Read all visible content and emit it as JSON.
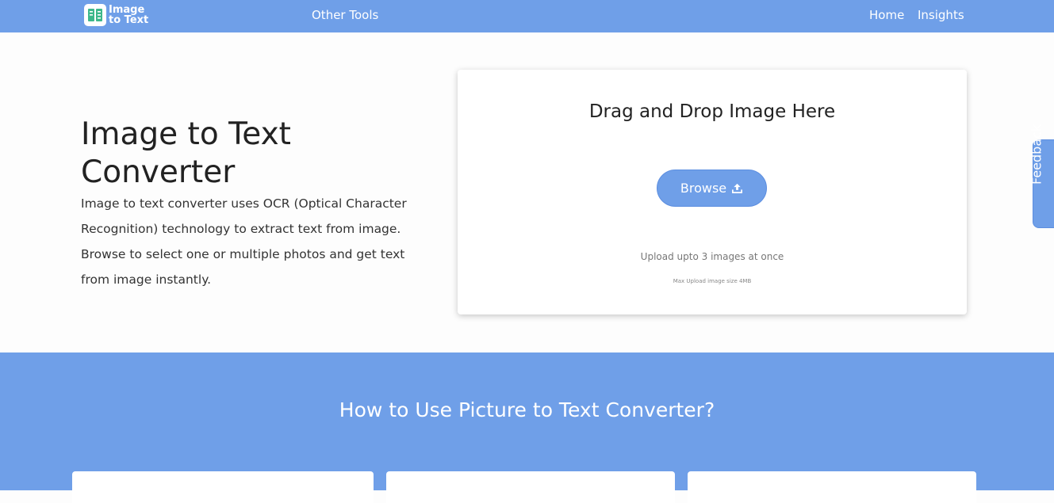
{
  "navbar": {
    "logo": {
      "line1": "Image",
      "line2": "to Text"
    },
    "links": {
      "other_tools": "Other Tools",
      "home": "Home",
      "insights": "Insights"
    }
  },
  "hero": {
    "title": "Image to Text Converter",
    "description": "Image to text converter uses OCR (Optical Character Recognition) technology to extract text from image. Browse to select one or multiple photos and get text from image instantly."
  },
  "upload": {
    "title": "Drag and Drop Image Here",
    "browse_label": "Browse",
    "note": "Upload upto 3 images at once",
    "max_size": "Max Upload image size 4MB"
  },
  "feedback": {
    "label": "Feedback"
  },
  "howto": {
    "title": "How to Use Picture to Text Converter?"
  },
  "colors": {
    "brand": "#6f9fe8",
    "logo_green": "#3db88b",
    "text_dark": "#222222",
    "card_bg": "#ffffff"
  },
  "icons": {
    "logo": "document-scan-icon",
    "browse": "upload-icon"
  }
}
